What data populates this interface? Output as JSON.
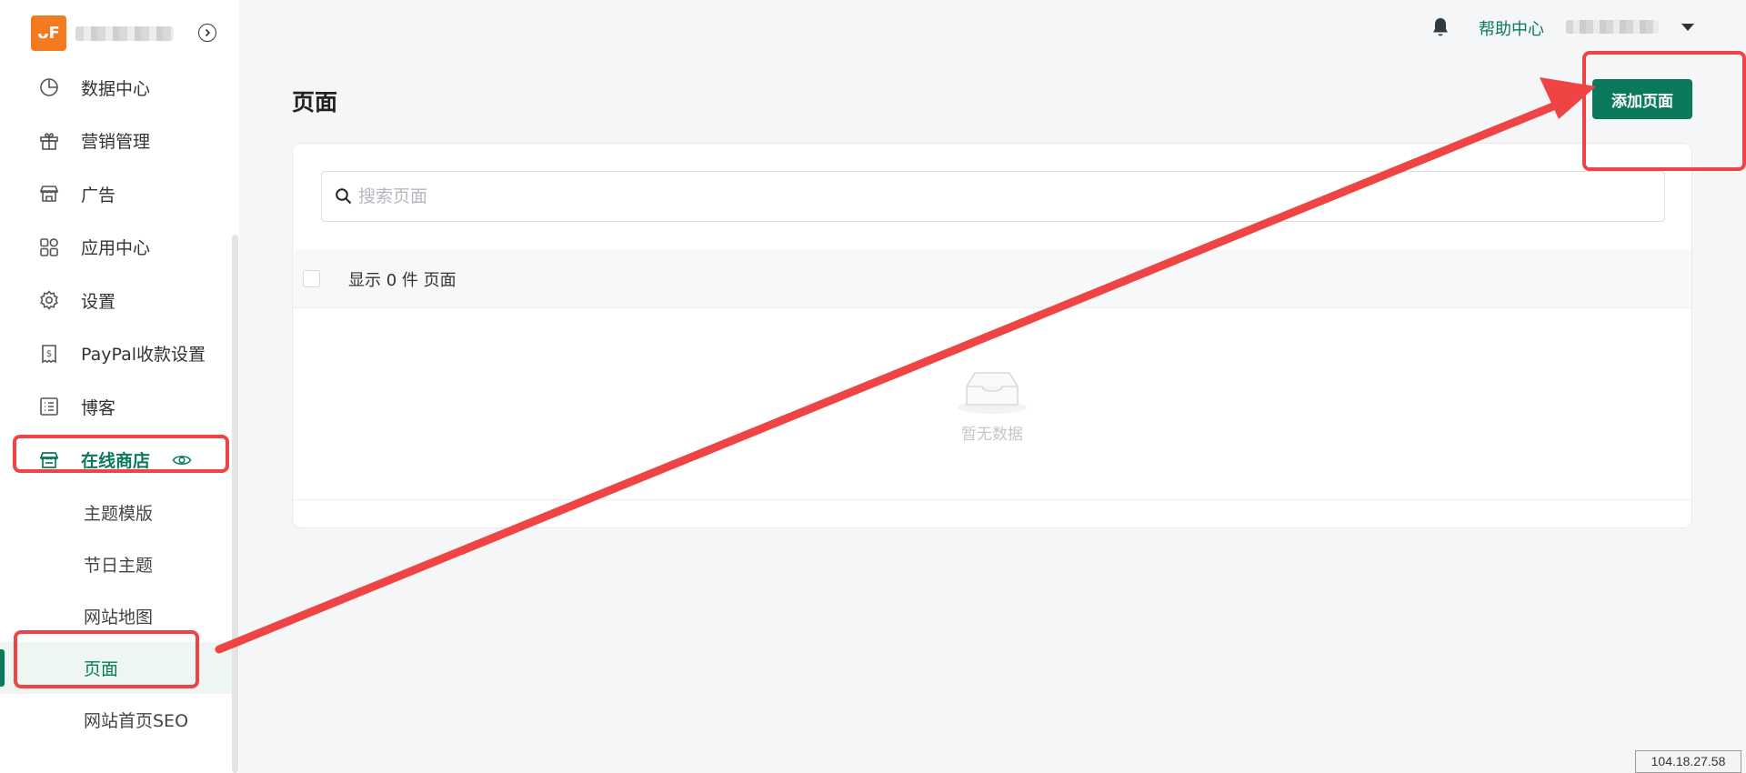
{
  "sidebar": {
    "logo_text": "ᴗF",
    "items": [
      {
        "label": "数据中心",
        "icon": "pie-chart-icon"
      },
      {
        "label": "营销管理",
        "icon": "gift-icon"
      },
      {
        "label": "广告",
        "icon": "storefront-icon"
      },
      {
        "label": "应用中心",
        "icon": "apps-icon"
      },
      {
        "label": "设置",
        "icon": "gear-icon"
      },
      {
        "label": "PayPal收款设置",
        "icon": "dollar-receipt-icon"
      },
      {
        "label": "博客",
        "icon": "list-icon"
      },
      {
        "label": "在线商店",
        "icon": "store-icon",
        "active": true
      }
    ],
    "sub_items": [
      {
        "label": "主题模版"
      },
      {
        "label": "节日主题"
      },
      {
        "label": "网站地图"
      },
      {
        "label": "页面",
        "selected": true
      },
      {
        "label": "网站首页SEO"
      }
    ]
  },
  "topbar": {
    "help_label": "帮助中心"
  },
  "main": {
    "title": "页面",
    "add_button_label": "添加页面",
    "search_placeholder": "搜索页面",
    "table_header_text": "显示 0 件 页面",
    "empty_text": "暂无数据"
  },
  "footer": {
    "ip": "104.18.27.58"
  },
  "colors": {
    "accent": "#0b7a5c",
    "logo": "#f47a20",
    "annotation": "#ef4444"
  }
}
